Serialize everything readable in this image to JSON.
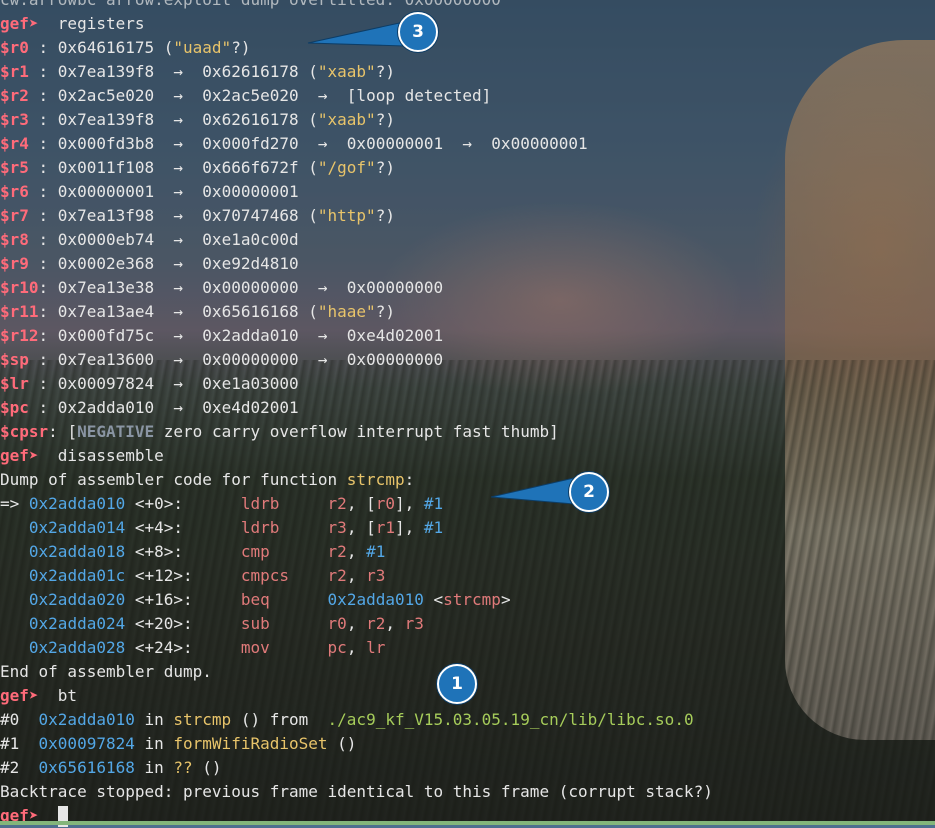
{
  "top_cutoff": "cw.arrowbc arrow:exploit dump overtitled: 0x00000000",
  "prompt": "gef➤",
  "cmd_registers": "registers",
  "registers": [
    {
      "name": "$r0",
      "chain": [],
      "value": "0x64616175",
      "string": "\"uaad\"",
      "suffix": "?)"
    },
    {
      "name": "$r1",
      "chain": [
        "0x7ea139f8",
        "0x62616178"
      ],
      "string": "\"xaab\"",
      "suffix": "?)"
    },
    {
      "name": "$r2",
      "chain": [
        "0x2ac5e020",
        "0x2ac5e020"
      ],
      "tail": "[loop detected]"
    },
    {
      "name": "$r3",
      "chain": [
        "0x7ea139f8",
        "0x62616178"
      ],
      "string": "\"xaab\"",
      "suffix": "?)"
    },
    {
      "name": "$r4",
      "chain": [
        "0x000fd3b8",
        "0x000fd270",
        "0x00000001",
        "0x00000001"
      ]
    },
    {
      "name": "$r5",
      "chain": [
        "0x0011f108",
        "0x666f672f"
      ],
      "string": "\"/gof\"",
      "suffix": "?)"
    },
    {
      "name": "$r6",
      "chain": [
        "0x00000001",
        "0x00000001"
      ]
    },
    {
      "name": "$r7",
      "chain": [
        "0x7ea13f98",
        "0x70747468"
      ],
      "string": "\"http\"",
      "suffix": "?)"
    },
    {
      "name": "$r8",
      "chain": [
        "0x0000eb74",
        "0xe1a0c00d"
      ]
    },
    {
      "name": "$r9",
      "chain": [
        "0x0002e368",
        "0xe92d4810"
      ]
    },
    {
      "name": "$r10",
      "chain": [
        "0x7ea13e38",
        "0x00000000",
        "0x00000000"
      ]
    },
    {
      "name": "$r11",
      "chain": [
        "0x7ea13ae4",
        "0x65616168"
      ],
      "string": "\"haae\"",
      "suffix": "?)"
    },
    {
      "name": "$r12",
      "chain": [
        "0x000fd75c",
        "0x2adda010",
        "0xe4d02001"
      ]
    },
    {
      "name": "$sp",
      "chain": [
        "0x7ea13600",
        "0x00000000",
        "0x00000000"
      ]
    },
    {
      "name": "$lr",
      "chain": [
        "0x00097824",
        "0xe1a03000"
      ]
    },
    {
      "name": "$pc",
      "chain": [
        "0x2adda010",
        "0xe4d02001"
      ]
    }
  ],
  "cpsr": {
    "name": "$cpsr",
    "open": "[",
    "neg": "NEGATIVE",
    "flags": "zero carry overflow interrupt fast thumb]"
  },
  "cmd_disassemble": "disassemble",
  "dump_header": "Dump of assembler code for function ",
  "dump_func": "strcmp",
  "dump_colon": ":",
  "asm": [
    {
      "marker": "=> ",
      "addr": "0x2adda010",
      "off": "<+0>:",
      "mn": "ldrb",
      "ops": [
        [
          "r2",
          1
        ],
        [
          ", ",
          0
        ],
        [
          "[",
          0
        ],
        [
          "r0",
          1
        ],
        [
          "], ",
          0
        ],
        [
          "#1",
          2
        ]
      ]
    },
    {
      "marker": "   ",
      "addr": "0x2adda014",
      "off": "<+4>:",
      "mn": "ldrb",
      "ops": [
        [
          "r3",
          1
        ],
        [
          ", ",
          0
        ],
        [
          "[",
          0
        ],
        [
          "r1",
          1
        ],
        [
          "], ",
          0
        ],
        [
          "#1",
          2
        ]
      ]
    },
    {
      "marker": "   ",
      "addr": "0x2adda018",
      "off": "<+8>:",
      "mn": "cmp",
      "ops": [
        [
          "r2",
          1
        ],
        [
          ", ",
          0
        ],
        [
          "#1",
          2
        ]
      ]
    },
    {
      "marker": "   ",
      "addr": "0x2adda01c",
      "off": "<+12>:",
      "mn": "cmpcs",
      "ops": [
        [
          "r2",
          1
        ],
        [
          ", ",
          0
        ],
        [
          "r3",
          1
        ]
      ]
    },
    {
      "marker": "   ",
      "addr": "0x2adda020",
      "off": "<+16>:",
      "mn": "beq",
      "ops": [
        [
          "0x2adda010",
          2
        ],
        [
          " <",
          0
        ],
        [
          "strcmp",
          1
        ],
        [
          ">",
          0
        ]
      ]
    },
    {
      "marker": "   ",
      "addr": "0x2adda024",
      "off": "<+20>:",
      "mn": "sub",
      "ops": [
        [
          "r0",
          1
        ],
        [
          ", ",
          0
        ],
        [
          "r2",
          1
        ],
        [
          ", ",
          0
        ],
        [
          "r3",
          1
        ]
      ]
    },
    {
      "marker": "   ",
      "addr": "0x2adda028",
      "off": "<+24>:",
      "mn": "mov",
      "ops": [
        [
          "pc",
          1
        ],
        [
          ", ",
          0
        ],
        [
          "lr",
          1
        ]
      ]
    }
  ],
  "dump_end": "End of assembler dump.",
  "cmd_bt": "bt",
  "bt": [
    {
      "num": "#0",
      "addr": "0x2adda010",
      "in": " in ",
      "func": "strcmp",
      "args": " () from ",
      "path": "./ac9_kf_V15.03.05.19_cn/lib/libc.so.0"
    },
    {
      "num": "#1",
      "addr": "0x00097824",
      "in": " in ",
      "func": "formWifiRadioSet",
      "args": " ()",
      "path": ""
    },
    {
      "num": "#2",
      "addr": "0x65616168",
      "in": " in ",
      "func": "??",
      "args": " ()",
      "path": ""
    }
  ],
  "bt_stop": "Backtrace stopped: previous frame identical to this frame (corrupt stack?)",
  "callouts": [
    {
      "label": "1"
    },
    {
      "label": "2"
    },
    {
      "label": "3"
    }
  ],
  "colors": {
    "prompt": "#ff6b7a",
    "string": "#e8c46a",
    "address": "#53a7e6",
    "function": "#a6cc5a",
    "callout": "#1f73b8"
  }
}
